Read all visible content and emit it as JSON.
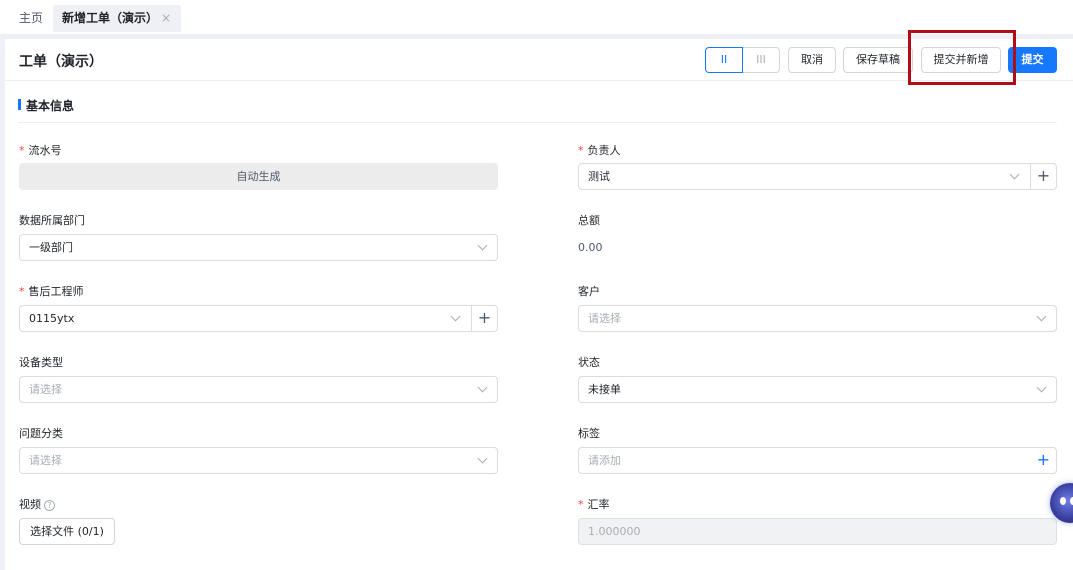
{
  "tabs": {
    "home": "主页",
    "active": "新增工单（演示）",
    "close": "×"
  },
  "header": {
    "title": "工单（演示）",
    "view_single": "II",
    "view_triple": "III",
    "cancel": "取消",
    "save_draft": "保存草稿",
    "submit_and_new": "提交并新增",
    "submit": "提交"
  },
  "section": {
    "title": "基本信息"
  },
  "form": {
    "required_mark": "*",
    "serial": {
      "label": "流水号",
      "value": "自动生成"
    },
    "owner": {
      "label": "负责人",
      "value": "测试"
    },
    "department": {
      "label": "数据所属部门",
      "value": "一级部门"
    },
    "total": {
      "label": "总额",
      "value": "0.00"
    },
    "engineer": {
      "label": "售后工程师",
      "value": "0115ytx"
    },
    "customer": {
      "label": "客户",
      "placeholder": "请选择"
    },
    "device_type": {
      "label": "设备类型",
      "placeholder": "请选择"
    },
    "status": {
      "label": "状态",
      "value": "未接单"
    },
    "issue_category": {
      "label": "问题分类",
      "placeholder": "请选择"
    },
    "tags": {
      "label": "标签",
      "placeholder": "请添加"
    },
    "video": {
      "label": "视频",
      "button": "选择文件 (0/1)"
    },
    "exchange_rate": {
      "label": "汇率",
      "value": "1.000000"
    }
  },
  "icons": {
    "plus": "+",
    "help": "?",
    "chevron": "chevron-down-icon"
  },
  "colors": {
    "primary": "#1677ff",
    "required": "#f53f3f",
    "highlight": "#b00d16"
  }
}
